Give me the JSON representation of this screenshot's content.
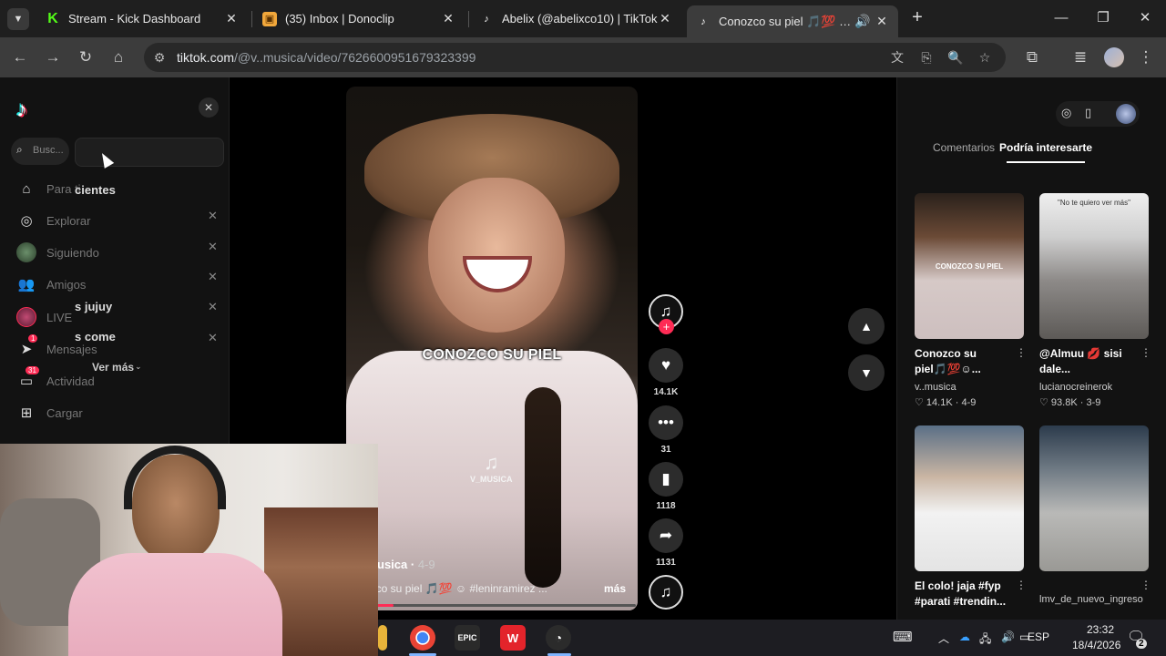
{
  "tabs": [
    {
      "title": "Stream - Kick Dashboard",
      "icon": "kick-icon"
    },
    {
      "title": "(35) Inbox | Donoclip",
      "icon": "donoclip-icon"
    },
    {
      "title": "Abelix (@abelixco10) | TikTok",
      "icon": "tiktok-icon"
    },
    {
      "title": "Conozco su piel 🎵💯 ☺ #",
      "icon": "tiktok-icon"
    }
  ],
  "address": {
    "domain": "tiktok.com",
    "path": "/@v..musica/video/7626600951679323399"
  },
  "sidebar": {
    "search_placeholder": "Busc...",
    "items": [
      {
        "label": "Para ti"
      },
      {
        "label": "Explorar"
      },
      {
        "label": "Siguiendo"
      },
      {
        "label": "Amigos"
      },
      {
        "label": "LIVE"
      },
      {
        "label": "Mensajes",
        "badge": "1"
      },
      {
        "label": "Actividad",
        "badge": "31"
      },
      {
        "label": "Cargar"
      }
    ],
    "recent_overlay": [
      "cientes",
      "s jujuy",
      "s come"
    ],
    "see_more": "Ver más"
  },
  "video": {
    "caption_overlay": "CONOZCO SU PIEL",
    "watermark": "V_MUSICA",
    "author": "usica",
    "date": "4-9",
    "description": "ozco su piel 🎵💯 ☺ #leninramirez ...",
    "more": "más",
    "progress": 0.07,
    "likes": "14.1K",
    "comments": "31",
    "saves": "1118",
    "shares": "1131",
    "avatar_label": "V_MUSICA"
  },
  "right_panel": {
    "tabs": [
      "Comentarios",
      "Podría interesarte"
    ],
    "active_tab": 1,
    "cards": [
      {
        "title": "Conozco su piel🎵💯☺...",
        "author": "v..musica",
        "likes": "14.1K",
        "date": "4-9",
        "thumb_text": "CONOZCO SU PIEL"
      },
      {
        "title": "@Almuu 💋 sisi dale...",
        "author": "lucianocreinerok",
        "likes": "93.8K",
        "date": "3-9",
        "thumb_text": "\"No te quiero ver más\""
      },
      {
        "title": "El colo! jaja #fyp #parati #trendin...",
        "author": "",
        "likes": "",
        "date": "",
        "thumb_text": ""
      },
      {
        "title": "",
        "author": "lmv_de_nuevo_ingreso",
        "likes": "",
        "date": "",
        "thumb_text": ""
      }
    ]
  },
  "taskbar": {
    "lang": "ESP",
    "time": "23:32",
    "date": "18/4/2026",
    "notif_count": "2"
  },
  "colors": {
    "accent": "#fe2c55",
    "bg": "#121212"
  }
}
